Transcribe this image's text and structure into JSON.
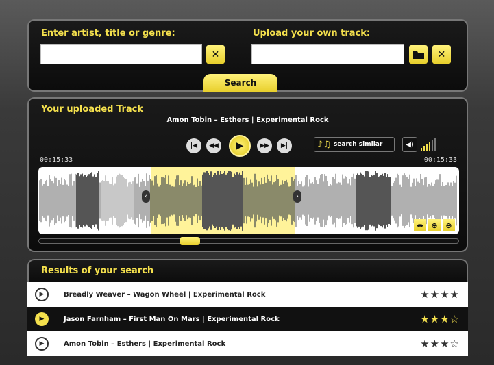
{
  "search": {
    "heading": "Enter artist, title or genre:",
    "value": "",
    "clear_icon": "close-icon",
    "button_label": "Search"
  },
  "upload": {
    "heading": "Upload your own track:",
    "value": "",
    "folder_icon": "folder-icon",
    "clear_icon": "close-icon"
  },
  "player": {
    "heading": "Your uploaded Track",
    "track": "Amon Tobin – Esthers | Experimental Rock",
    "controls": [
      "skip-back-icon",
      "rewind-icon",
      "play-icon",
      "fast-forward-icon",
      "skip-forward-icon"
    ],
    "similar_label": "search similar",
    "time_left": "00:15:33",
    "time_right": "00:15:33",
    "accent_color": "#f4e04d"
  },
  "results": {
    "heading": "Results of your search",
    "rows": [
      {
        "text": "Breadly Weaver – Wagon Wheel | Experimental Rock",
        "stars": "★★★★",
        "rating": 4,
        "selected": false
      },
      {
        "text": "Jason Farnham – First Man On Mars | Experimental Rock",
        "stars": "★★★☆",
        "rating": 3,
        "selected": true
      },
      {
        "text": "Amon Tobin – Esthers | Experimental Rock",
        "stars": "★★★☆",
        "rating": 3,
        "selected": false
      }
    ]
  }
}
